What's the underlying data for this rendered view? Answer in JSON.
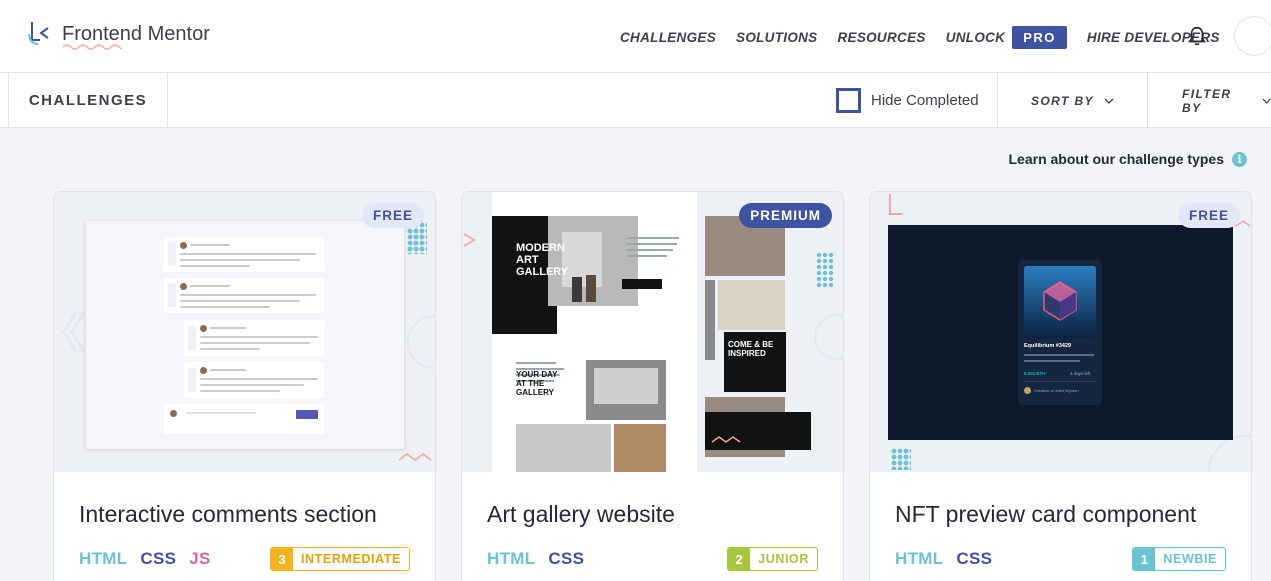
{
  "brand": {
    "name": "Frontend Mentor"
  },
  "nav": {
    "items": [
      "Challenges",
      "Solutions",
      "Resources",
      "Unlock"
    ],
    "pro_label": "PRO",
    "hire_label": "Hire Developers"
  },
  "filterbar": {
    "title": "CHALLENGES",
    "hide_completed": "Hide Completed",
    "sort_by": "SORT BY",
    "filter_by": "FILTER BY"
  },
  "learn": {
    "label": "Learn about our challenge types",
    "icon": "info-icon"
  },
  "cards": [
    {
      "title": "Interactive comments section",
      "badge": "FREE",
      "tags": [
        "HTML",
        "CSS",
        "JS"
      ],
      "level_num": "3",
      "level_label": "INTERMEDIATE",
      "level_color": "#f5b320",
      "level_text_color": "#e6a300"
    },
    {
      "title": "Art gallery website",
      "badge": "PREMIUM",
      "tags": [
        "HTML",
        "CSS"
      ],
      "level_num": "2",
      "level_label": "JUNIOR",
      "level_color": "#a6c63e",
      "level_text_color": "#a6c63e",
      "preview": {
        "heading1": "MODERN ART GALLERY",
        "heading2": "YOUR DAY AT THE GALLERY",
        "heading3": "COME & BE INSPIRED"
      }
    },
    {
      "title": "NFT preview card component",
      "badge": "FREE",
      "tags": [
        "HTML",
        "CSS"
      ],
      "level_num": "1",
      "level_label": "NEWBIE",
      "level_color": "#6bc3d2",
      "level_text_color": "#6bc3d2",
      "preview": {
        "nft_title": "Equilibrium #3429",
        "price": "0.041 ETH",
        "time": "3 days left",
        "creator": "Creation of Jules Wyvern"
      }
    }
  ],
  "colors": {
    "accent": "#3e54a3",
    "teal": "#6bc3d2",
    "pink": "#d6689d"
  }
}
